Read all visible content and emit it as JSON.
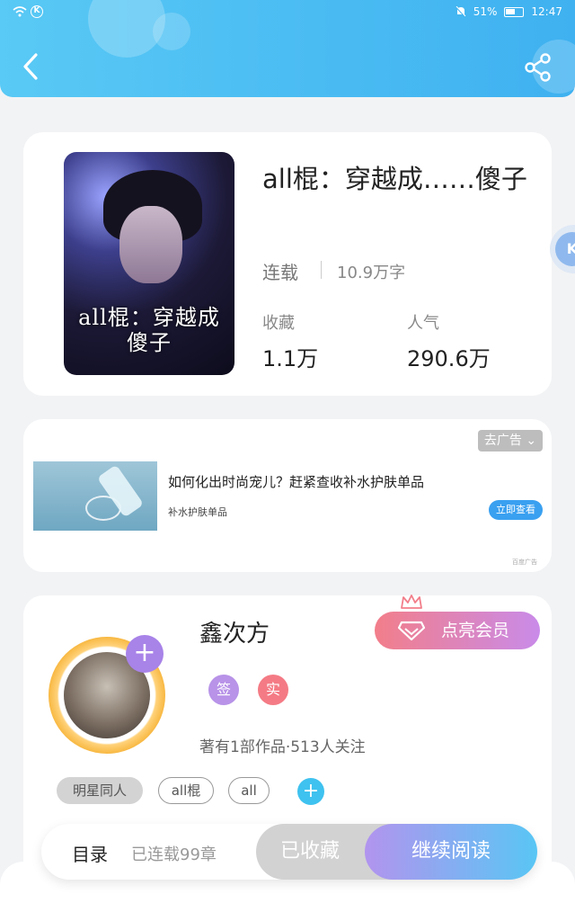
{
  "status_bar": {
    "battery": "51%",
    "time": "12:47",
    "k_badge": "K"
  },
  "book": {
    "title": "all棍：穿越成……傻子",
    "cover_text": "all棍：穿越成\n傻子",
    "status": "连载",
    "words": "10.9万字",
    "favorites_label": "收藏",
    "favorites_value": "1.1万",
    "popularity_label": "人气",
    "popularity_value": "290.6万"
  },
  "ad": {
    "remove_label": "去广告",
    "title": "如何化出时尚宠儿？赶紧查收补水护肤单品",
    "subtitle": "补水护肤单品",
    "cta_label": "立即查看",
    "source": "百度广告"
  },
  "author": {
    "name": "鑫次方",
    "vip_label": "点亮会员",
    "badge_sign": "签",
    "badge_real": "实",
    "meta": "著有1部作品·513人关注",
    "tags": [
      "明星同人",
      "all棍",
      "all"
    ],
    "add_tag": "+",
    "avatar_plus": "+"
  },
  "bottom_bar": {
    "toc_label": "目录",
    "chapters_label": "已连载99章",
    "collected_label": "已收藏",
    "read_label": "继续阅读"
  },
  "float_button": {
    "label": "K"
  },
  "colors": {
    "header": "#3fb1f0",
    "vip_gradient_start": "#f27e8a",
    "vip_gradient_end": "#c98be9",
    "badge_sign": "#b893e8",
    "badge_real": "#f47b85",
    "read_gradient_start": "#b294ee",
    "read_gradient_end": "#59c6f4",
    "tag_add": "#3fc2ef"
  },
  "icons": [
    "back-arrow-icon",
    "share-icon",
    "wifi-icon",
    "mute-icon",
    "battery-icon",
    "diamond-icon",
    "crown-icon",
    "chevron-down-icon",
    "plus-icon"
  ]
}
